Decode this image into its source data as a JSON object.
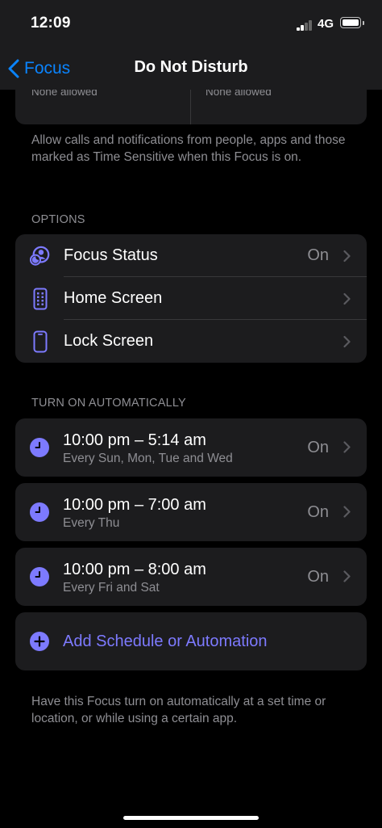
{
  "status_bar": {
    "time": "12:09",
    "network": "4G"
  },
  "nav": {
    "back_label": "Focus",
    "title": "Do Not Disturb"
  },
  "allowed": {
    "people": "None allowed",
    "apps": "None allowed"
  },
  "allowed_footnote": "Allow calls and notifications from people, apps and those marked as Time Sensitive when this Focus is on.",
  "options": {
    "header": "OPTIONS",
    "items": [
      {
        "label": "Focus Status",
        "value": "On",
        "icon": "focus-status-icon"
      },
      {
        "label": "Home Screen",
        "value": "",
        "icon": "home-screen-icon"
      },
      {
        "label": "Lock Screen",
        "value": "",
        "icon": "lock-screen-icon"
      }
    ]
  },
  "automatic": {
    "header": "TURN ON AUTOMATICALLY",
    "schedules": [
      {
        "time": "10:00 pm – 5:14 am",
        "days": "Every Sun, Mon, Tue and Wed",
        "value": "On"
      },
      {
        "time": "10:00 pm – 7:00 am",
        "days": "Every Thu",
        "value": "On"
      },
      {
        "time": "10:00 pm – 8:00 am",
        "days": "Every Fri and Sat",
        "value": "On"
      }
    ],
    "add_label": "Add Schedule or Automation",
    "footnote": "Have this Focus turn on automatically at a set time or location, or while using a certain app."
  },
  "colors": {
    "accent": "#7d7aff",
    "link": "#0a84ff",
    "card": "#1c1c1e",
    "secondary_text": "#8e8e93"
  }
}
